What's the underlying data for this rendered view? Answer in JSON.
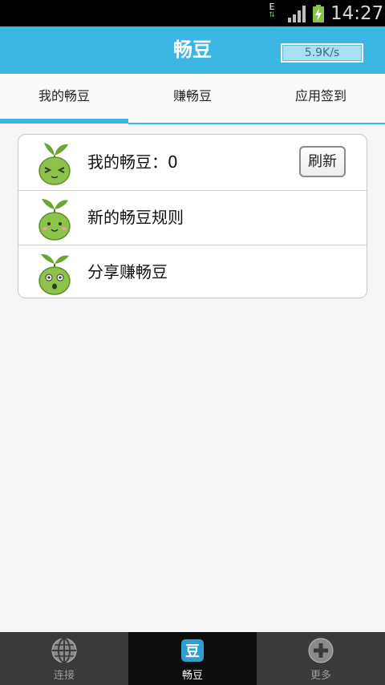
{
  "status_bar": {
    "network_type": "E",
    "network_arrows": "⇅",
    "time": "14:27"
  },
  "header": {
    "title": "畅豆",
    "speed": "5.9K/s"
  },
  "tabs": [
    {
      "label": "我的畅豆",
      "selected": true
    },
    {
      "label": "赚畅豆",
      "selected": false
    },
    {
      "label": "应用签到",
      "selected": false
    }
  ],
  "bean_list": {
    "my_beans_label": "我的畅豆：",
    "my_beans_value": "0",
    "refresh_label": "刷新",
    "rules_label": "新的畅豆规则",
    "share_label": "分享赚畅豆"
  },
  "bottom_nav": [
    {
      "label": "连接",
      "icon": "globe-icon",
      "selected": false
    },
    {
      "label": "畅豆",
      "icon": "bean-icon",
      "glyph": "豆",
      "selected": true
    },
    {
      "label": "更多",
      "icon": "plus-circle-icon",
      "selected": false
    }
  ],
  "colors": {
    "accent": "#3cb7e4",
    "bean_green": "#8dc34a",
    "nav_bg": "#3a3a3a"
  }
}
